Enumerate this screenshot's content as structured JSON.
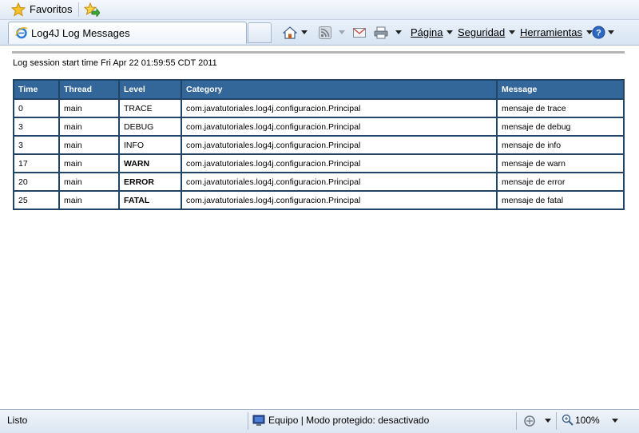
{
  "favorites_bar": {
    "favorites_label": "Favoritos"
  },
  "tab": {
    "title": "Log4J Log Messages"
  },
  "command_bar": {
    "page_label": "Página",
    "safety_label": "Seguridad",
    "tools_label": "Herramientas"
  },
  "content": {
    "session_text": "Log session start time Fri Apr 22 01:59:55 CDT 2011",
    "table": {
      "headers": [
        "Time",
        "Thread",
        "Level",
        "Category",
        "Message"
      ],
      "rows": [
        {
          "time": "0",
          "thread": "main",
          "level": "TRACE",
          "category": "com.javatutoriales.log4j.configuracion.Principal",
          "message": "mensaje de trace"
        },
        {
          "time": "3",
          "thread": "main",
          "level": "DEBUG",
          "category": "com.javatutoriales.log4j.configuracion.Principal",
          "message": "mensaje de debug"
        },
        {
          "time": "3",
          "thread": "main",
          "level": "INFO",
          "category": "com.javatutoriales.log4j.configuracion.Principal",
          "message": "mensaje de info"
        },
        {
          "time": "17",
          "thread": "main",
          "level": "WARN",
          "category": "com.javatutoriales.log4j.configuracion.Principal",
          "message": "mensaje de warn"
        },
        {
          "time": "20",
          "thread": "main",
          "level": "ERROR",
          "category": "com.javatutoriales.log4j.configuracion.Principal",
          "message": "mensaje de error"
        },
        {
          "time": "25",
          "thread": "main",
          "level": "FATAL",
          "category": "com.javatutoriales.log4j.configuracion.Principal",
          "message": "mensaje de fatal"
        }
      ]
    }
  },
  "status_bar": {
    "status_text": "Listo",
    "zone_text": "Equipo | Modo protegido: desactivado",
    "zoom_text": "100%"
  },
  "colors": {
    "header_bg": "#336699",
    "debug": "#339933",
    "warn_error_fatal": "#993300"
  }
}
